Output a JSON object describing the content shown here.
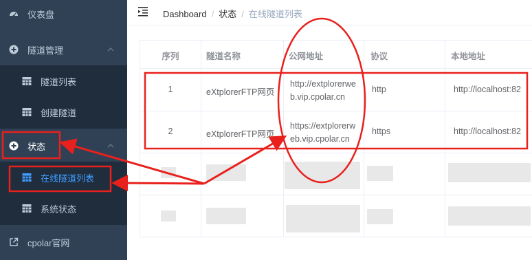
{
  "sidebar": {
    "items": [
      {
        "label": "仪表盘",
        "icon": "dashboard-icon"
      },
      {
        "label": "隧道管理",
        "icon": "plus-circle-icon"
      },
      {
        "label": "隧道列表",
        "icon": "grid-icon"
      },
      {
        "label": "创建隧道",
        "icon": "grid-icon"
      },
      {
        "label": "状态",
        "icon": "plus-circle-icon"
      },
      {
        "label": "在线隧道列表",
        "icon": "grid-icon"
      },
      {
        "label": "系统状态",
        "icon": "grid-icon"
      },
      {
        "label": "cpolar官网",
        "icon": "external-link-icon"
      }
    ]
  },
  "header": {
    "breadcrumb": [
      "Dashboard",
      "状态",
      "在线隧道列表"
    ]
  },
  "table": {
    "columns": [
      "序列",
      "隧道名称",
      "公网地址",
      "协议",
      "本地地址"
    ],
    "rows": [
      {
        "index": "1",
        "name": "eXtplorerFTP网页",
        "url_line1": "http://extplorerwe",
        "url_line2": "b.vip.cpolar.cn",
        "protocol": "http",
        "local": "http://localhost:82"
      },
      {
        "index": "2",
        "name": "eXtplorerFTP网页",
        "url_line1": "https://extplorerw",
        "url_line2": "eb.vip.cpolar.cn",
        "protocol": "https",
        "local": "http://localhost:82"
      }
    ]
  },
  "colors": {
    "sidebar_bg": "#304156",
    "submenu_bg": "#1f2d3d",
    "sidebar_text": "#bfcbd9",
    "active": "#409eff",
    "annotation_red": "#e8211d"
  }
}
